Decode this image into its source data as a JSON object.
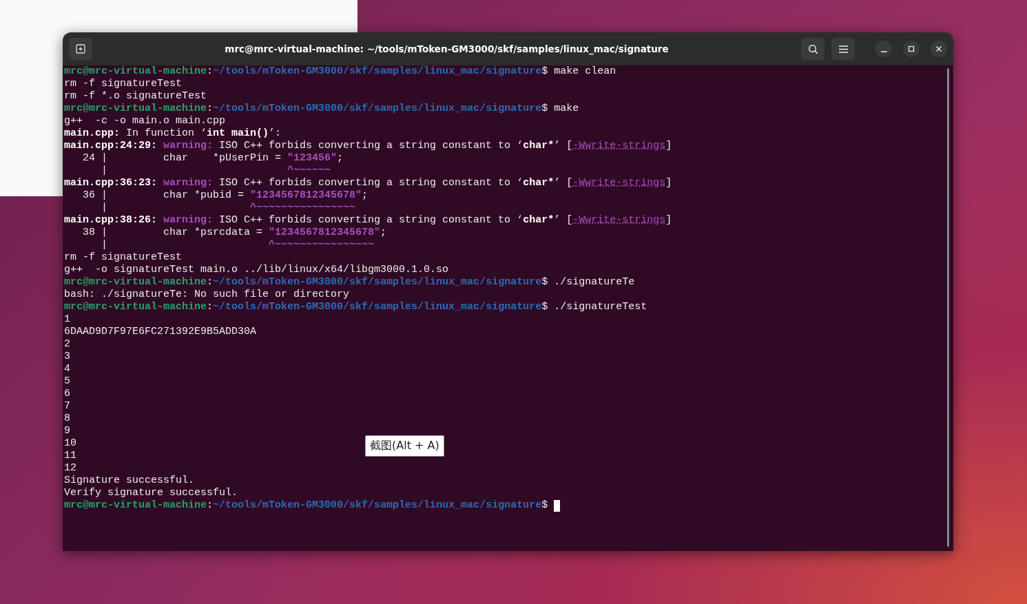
{
  "window": {
    "title": "mrc@mrc-virtual-machine: ~/tools/mToken-GM3000/skf/samples/linux_mac/signature"
  },
  "terminal": {
    "cursor": true,
    "lines": [
      [
        {
          "kind": "user",
          "text": "mrc@mrc-virtual-machine"
        },
        {
          "kind": "normal",
          "text": ":"
        },
        {
          "kind": "path",
          "text": "~/tools/mToken-GM3000/skf/samples/linux_mac/signature"
        },
        {
          "kind": "normal",
          "text": "$ make clean"
        }
      ],
      [
        {
          "kind": "normal",
          "text": "rm -f signatureTest"
        }
      ],
      [
        {
          "kind": "normal",
          "text": "rm -f *.o signatureTest"
        }
      ],
      [
        {
          "kind": "user",
          "text": "mrc@mrc-virtual-machine"
        },
        {
          "kind": "normal",
          "text": ":"
        },
        {
          "kind": "path",
          "text": "~/tools/mToken-GM3000/skf/samples/linux_mac/signature"
        },
        {
          "kind": "normal",
          "text": "$ make"
        }
      ],
      [
        {
          "kind": "normal",
          "text": "g++  -c -o main.o main.cpp"
        }
      ],
      [
        {
          "kind": "bold",
          "text": "main.cpp:"
        },
        {
          "kind": "normal",
          "text": " In function ‘"
        },
        {
          "kind": "bold",
          "text": "int main()"
        },
        {
          "kind": "normal",
          "text": "’:"
        }
      ],
      [
        {
          "kind": "bold",
          "text": "main.cpp:24:29: "
        },
        {
          "kind": "magenta",
          "text": "warning:"
        },
        {
          "kind": "normal",
          "text": " ISO C++ forbids converting a string constant to ‘"
        },
        {
          "kind": "bold",
          "text": "char*"
        },
        {
          "kind": "normal",
          "text": "’ ["
        },
        {
          "kind": "flag",
          "text": "-Wwrite-strings"
        },
        {
          "kind": "normal",
          "text": "]"
        }
      ],
      [
        {
          "kind": "normal",
          "text": "   24 |         char    *pUserPin = "
        },
        {
          "kind": "magenta",
          "text": "\"123456\""
        },
        {
          "kind": "normal",
          "text": ";"
        }
      ],
      [
        {
          "kind": "normal",
          "text": "      |                             "
        },
        {
          "kind": "magenta",
          "text": "^~~~~~~"
        }
      ],
      [
        {
          "kind": "bold",
          "text": "main.cpp:36:23: "
        },
        {
          "kind": "magenta",
          "text": "warning:"
        },
        {
          "kind": "normal",
          "text": " ISO C++ forbids converting a string constant to ‘"
        },
        {
          "kind": "bold",
          "text": "char*"
        },
        {
          "kind": "normal",
          "text": "’ ["
        },
        {
          "kind": "flag",
          "text": "-Wwrite-strings"
        },
        {
          "kind": "normal",
          "text": "]"
        }
      ],
      [
        {
          "kind": "normal",
          "text": "   36 |         char *pubid = "
        },
        {
          "kind": "magenta",
          "text": "\"1234567812345678\""
        },
        {
          "kind": "normal",
          "text": ";"
        }
      ],
      [
        {
          "kind": "normal",
          "text": "      |                       "
        },
        {
          "kind": "magenta",
          "text": "^~~~~~~~~~~~~~~~~"
        }
      ],
      [
        {
          "kind": "bold",
          "text": "main.cpp:38:26: "
        },
        {
          "kind": "magenta",
          "text": "warning:"
        },
        {
          "kind": "normal",
          "text": " ISO C++ forbids converting a string constant to ‘"
        },
        {
          "kind": "bold",
          "text": "char*"
        },
        {
          "kind": "normal",
          "text": "’ ["
        },
        {
          "kind": "flag",
          "text": "-Wwrite-strings"
        },
        {
          "kind": "normal",
          "text": "]"
        }
      ],
      [
        {
          "kind": "normal",
          "text": "   38 |         char *psrcdata = "
        },
        {
          "kind": "magenta",
          "text": "\"1234567812345678\""
        },
        {
          "kind": "normal",
          "text": ";"
        }
      ],
      [
        {
          "kind": "normal",
          "text": "      |                          "
        },
        {
          "kind": "magenta",
          "text": "^~~~~~~~~~~~~~~~~"
        }
      ],
      [
        {
          "kind": "normal",
          "text": "rm -f signatureTest"
        }
      ],
      [
        {
          "kind": "normal",
          "text": "g++  -o signatureTest main.o ../lib/linux/x64/libgm3000.1.0.so"
        }
      ],
      [
        {
          "kind": "user",
          "text": "mrc@mrc-virtual-machine"
        },
        {
          "kind": "normal",
          "text": ":"
        },
        {
          "kind": "path",
          "text": "~/tools/mToken-GM3000/skf/samples/linux_mac/signature"
        },
        {
          "kind": "normal",
          "text": "$ ./signatureTe"
        }
      ],
      [
        {
          "kind": "normal",
          "text": "bash: ./signatureTe: No such file or directory"
        }
      ],
      [
        {
          "kind": "user",
          "text": "mrc@mrc-virtual-machine"
        },
        {
          "kind": "normal",
          "text": ":"
        },
        {
          "kind": "path",
          "text": "~/tools/mToken-GM3000/skf/samples/linux_mac/signature"
        },
        {
          "kind": "normal",
          "text": "$ ./signatureTest"
        }
      ],
      [
        {
          "kind": "normal",
          "text": "1"
        }
      ],
      [
        {
          "kind": "normal",
          "text": "6DAAD9D7F97E6FC271392E9B5ADD30A"
        }
      ],
      [
        {
          "kind": "normal",
          "text": "2"
        }
      ],
      [
        {
          "kind": "normal",
          "text": "3"
        }
      ],
      [
        {
          "kind": "normal",
          "text": "4"
        }
      ],
      [
        {
          "kind": "normal",
          "text": "5"
        }
      ],
      [
        {
          "kind": "normal",
          "text": "6"
        }
      ],
      [
        {
          "kind": "normal",
          "text": "7"
        }
      ],
      [
        {
          "kind": "normal",
          "text": "8"
        }
      ],
      [
        {
          "kind": "normal",
          "text": "9"
        }
      ],
      [
        {
          "kind": "normal",
          "text": "10"
        }
      ],
      [
        {
          "kind": "normal",
          "text": "11"
        }
      ],
      [
        {
          "kind": "normal",
          "text": "12"
        }
      ],
      [
        {
          "kind": "normal",
          "text": "Signature successful."
        }
      ],
      [
        {
          "kind": "normal",
          "text": "Verify signature successful."
        }
      ],
      [
        {
          "kind": "user",
          "text": "mrc@mrc-virtual-machine"
        },
        {
          "kind": "normal",
          "text": ":"
        },
        {
          "kind": "path",
          "text": "~/tools/mToken-GM3000/skf/samples/linux_mac/signature"
        },
        {
          "kind": "normal",
          "text": "$ "
        }
      ]
    ]
  },
  "tooltip": {
    "text": "截图(Alt + A)"
  }
}
